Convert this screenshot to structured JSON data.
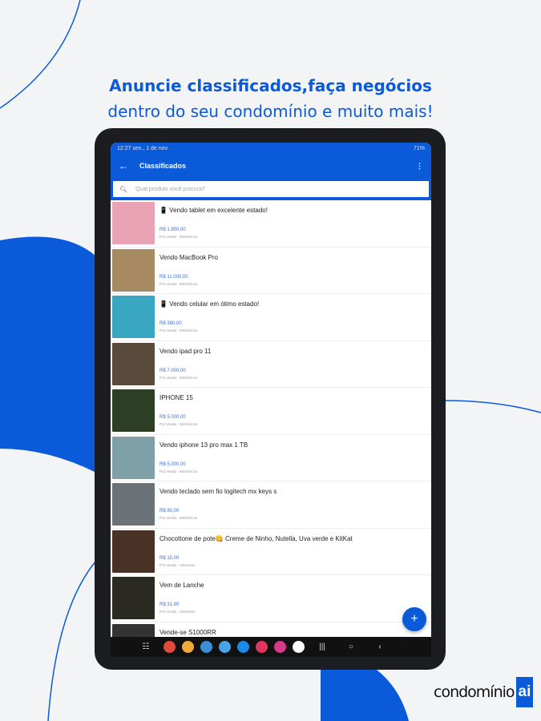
{
  "headline": {
    "line1": "Anuncie classificados,faça negócios",
    "line2": "dentro do seu condomínio e muito mais!"
  },
  "status": {
    "time": "12:27",
    "date": "sex., 1 de nov.",
    "battery": "71%"
  },
  "appbar": {
    "back": "←",
    "title": "Classificados",
    "menu": "⋮"
  },
  "search": {
    "icon": "search-icon",
    "placeholder": "Qual produto você procura?"
  },
  "items": [
    {
      "title": "📱 Vendo tablet em excelente estado!",
      "price": "R$ 1.850,00",
      "meta": "Pra Venda · Eletrônicos",
      "color": "#e9a3b4"
    },
    {
      "title": "Vendo MacBook Pro",
      "price": "R$ 11.000,00",
      "meta": "Pra Venda · Eletrônicos",
      "color": "#a88a62"
    },
    {
      "title": "📱 Vendo celular em ótimo estado!",
      "price": "R$ 380,00",
      "meta": "Pra Venda · Eletrônicos",
      "color": "#3aa7c2"
    },
    {
      "title": "Vendo ipad pro 11",
      "price": "R$ 7.000,00",
      "meta": "Pra Venda · Eletrônicos",
      "color": "#5a4a3c"
    },
    {
      "title": "IPHONE 15",
      "price": "R$ 5.000,00",
      "meta": "Pra Venda · Eletrônicos",
      "color": "#2c3f25"
    },
    {
      "title": "Vendo iphone 13 pro max 1 TB",
      "price": "R$ 5.000,00",
      "meta": "Pra Venda · Eletrônicos",
      "color": "#7fa0a8"
    },
    {
      "title": "Vendo teclado sem fio logitech mx keys s",
      "price": "R$ 80,00",
      "meta": "Pra Venda · Eletrônicos",
      "color": "#6b7378"
    },
    {
      "title": "Chocottone de pote😋 Creme de Ninho, Nutella, Uva verde e KitKat",
      "price": "R$ 15,00",
      "meta": "Pra Venda · Alimentos",
      "color": "#4a3126"
    },
    {
      "title": "Vem de Lanche",
      "price": "R$ 31,90",
      "meta": "Pra Venda · Alimentos",
      "color": "#2a2a22"
    },
    {
      "title": "Vende-se S1000RR",
      "price": "",
      "meta": "",
      "color": "#333"
    }
  ],
  "fab": "+",
  "logo": {
    "word": "condomínio",
    "badge": "ai"
  }
}
